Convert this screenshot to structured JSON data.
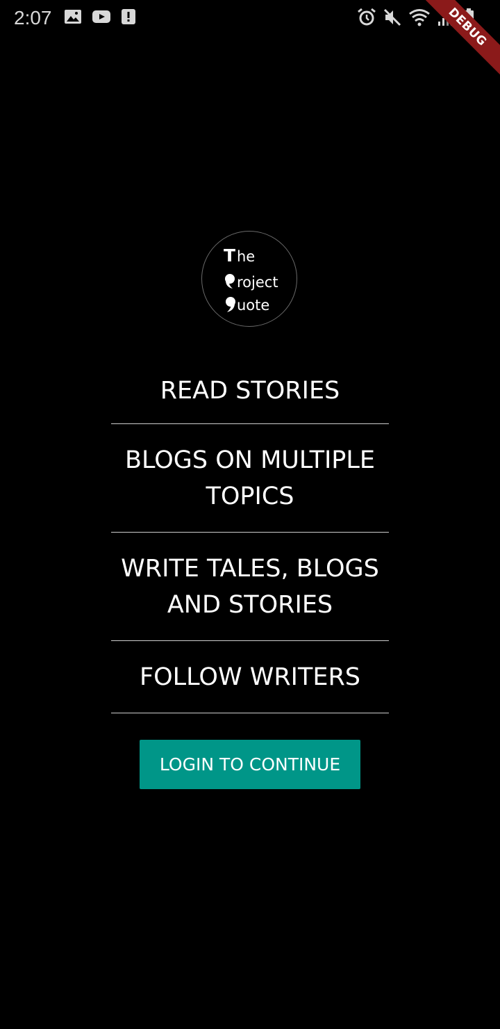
{
  "status_bar": {
    "time": "2:07",
    "left_icons": [
      "image-icon",
      "youtube-icon",
      "alert-icon"
    ],
    "right_icons": [
      "alarm-icon",
      "mute-icon",
      "wifi-icon",
      "signal-icon",
      "battery-icon"
    ]
  },
  "debug_banner": {
    "label": "DEBUG",
    "color": "#8b1a1a"
  },
  "logo": {
    "line1_initial": "T",
    "line1_rest": "he",
    "line2_rest": "roject",
    "line3_rest": "uote"
  },
  "features": [
    {
      "label": "READ STORIES"
    },
    {
      "label": "BLOGS ON MULTIPLE TOPICS"
    },
    {
      "label": "WRITE TALES, BLOGS AND STORIES"
    },
    {
      "label": "FOLLOW WRITERS"
    }
  ],
  "login_button": {
    "label": "LOGIN TO CONTINUE",
    "color": "#009688"
  },
  "colors": {
    "background": "#000000",
    "text": "#ffffff",
    "divider": "#cfcfcf"
  }
}
